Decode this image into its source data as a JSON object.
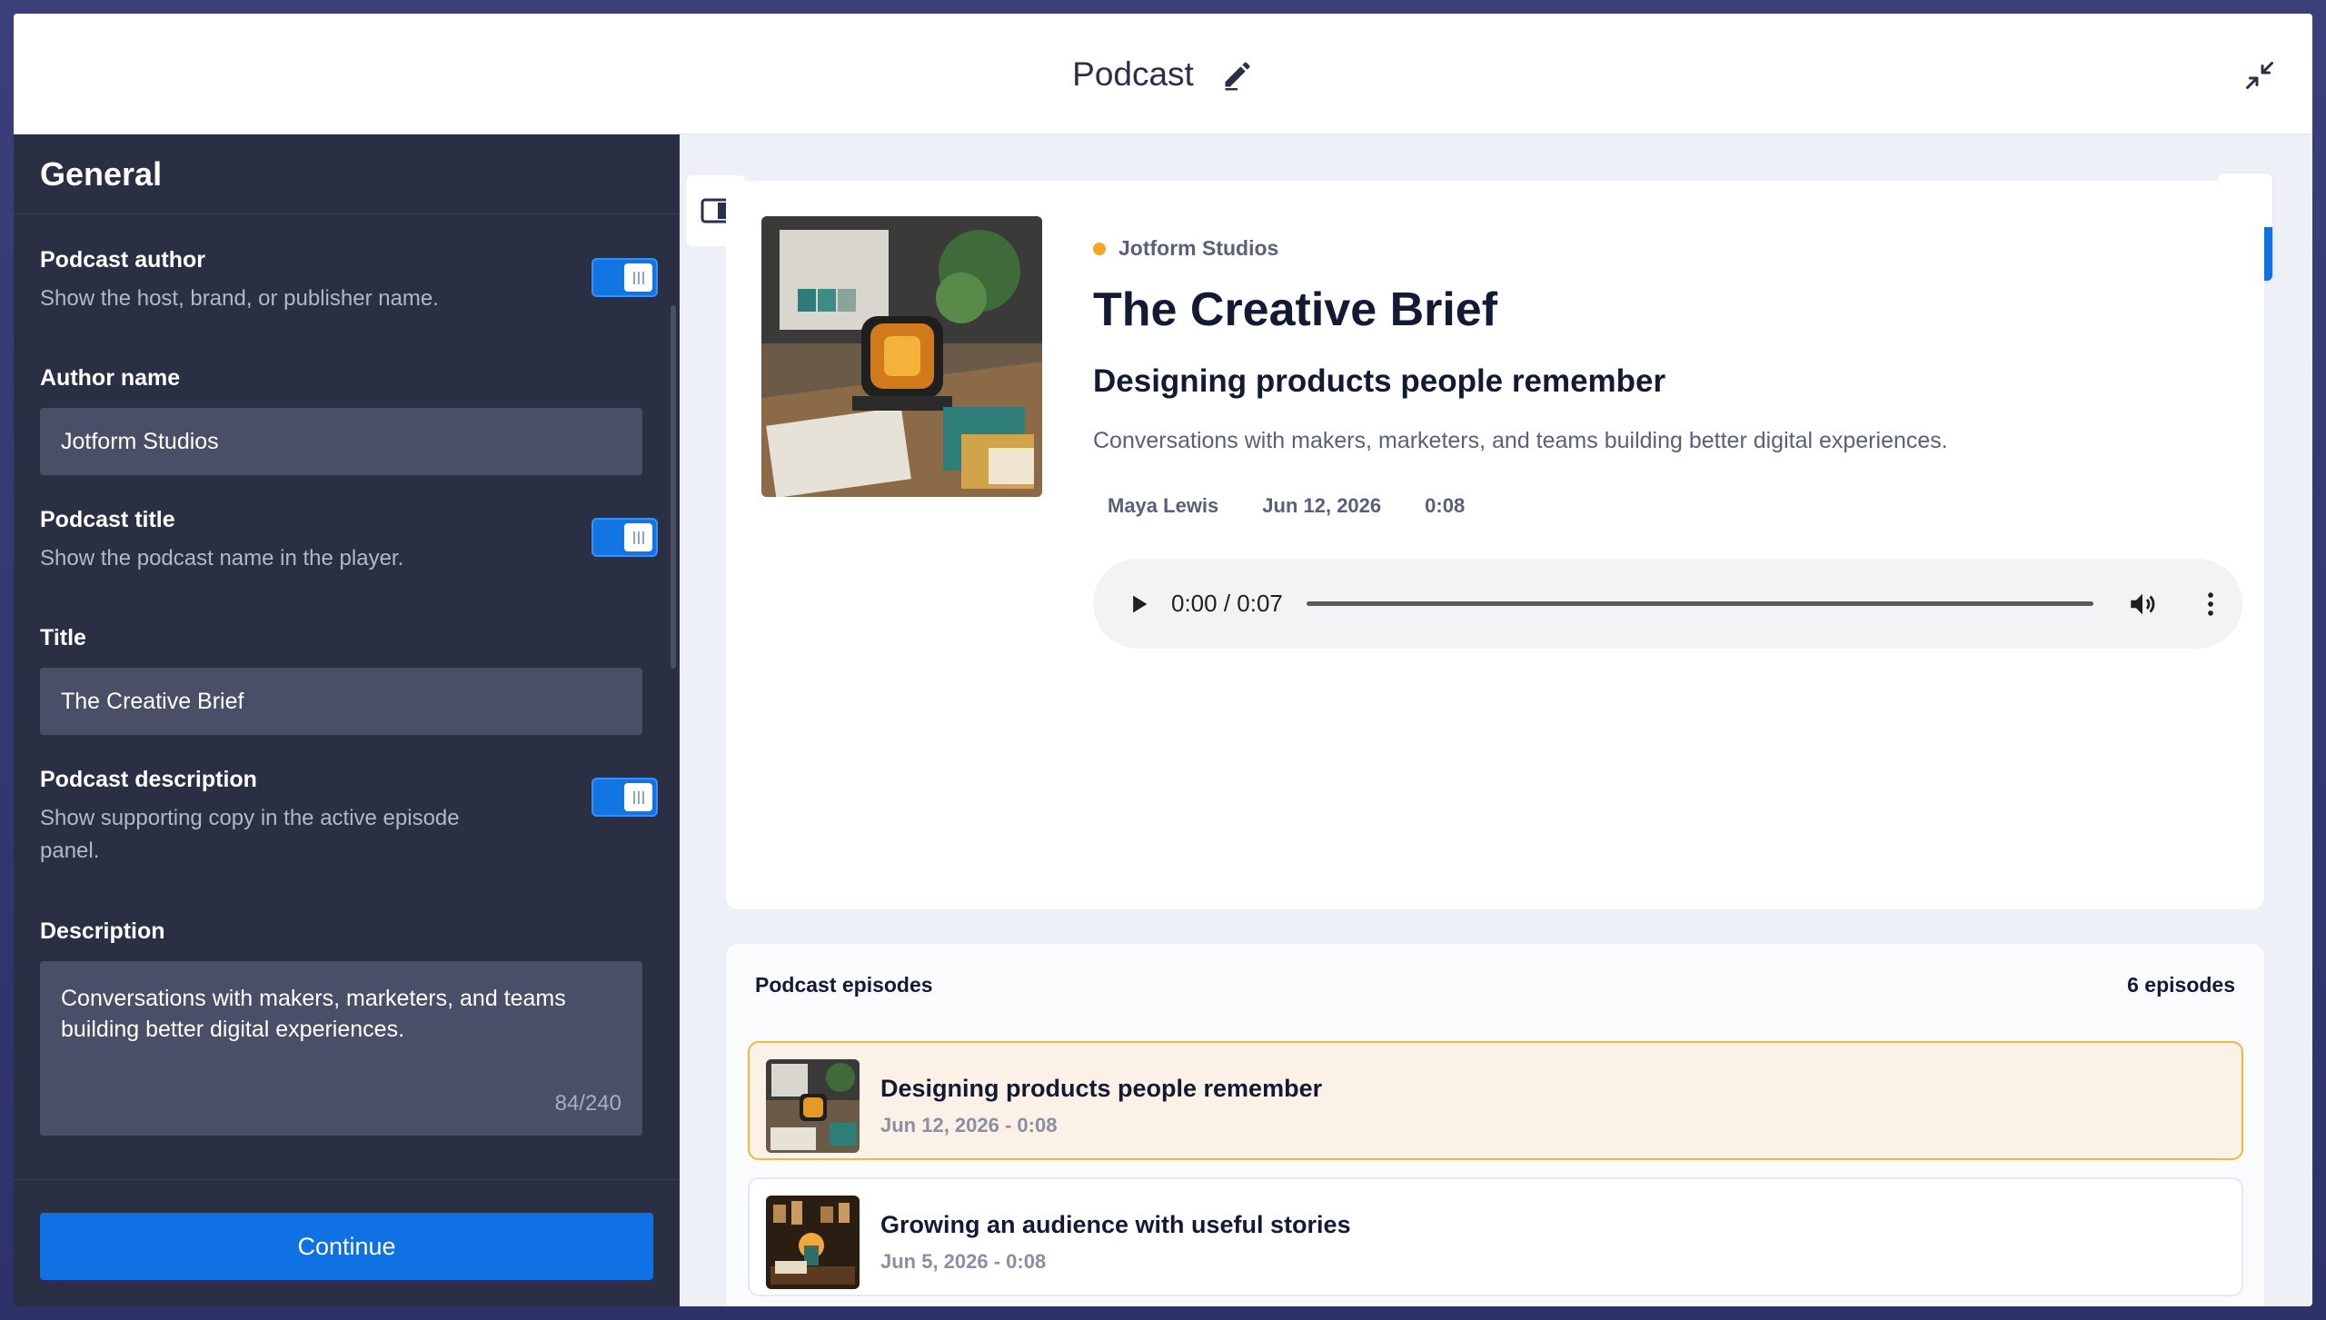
{
  "header": {
    "title": "Podcast"
  },
  "sidebar": {
    "heading": "General",
    "podcast_author": {
      "label": "Podcast author",
      "desc": "Show the host, brand, or publisher name."
    },
    "author_name": {
      "label": "Author name",
      "value": "Jotform Studios"
    },
    "podcast_title": {
      "label": "Podcast title",
      "desc": "Show the podcast name in the player."
    },
    "title_field": {
      "label": "Title",
      "value": "The Creative Brief"
    },
    "podcast_description": {
      "label": "Podcast description",
      "desc": "Show supporting copy in the active episode panel."
    },
    "description_field": {
      "label": "Description",
      "value": "Conversations with makers, marketers, and teams building better digital experiences.",
      "counter": "84/240"
    },
    "continue_label": "Continue"
  },
  "player": {
    "studio": "Jotform Studios",
    "title": "The Creative Brief",
    "episode_title": "Designing products people remember",
    "description": "Conversations with makers, marketers, and teams building better digital experiences.",
    "meta": {
      "author": "Maya Lewis",
      "date": "Jun 12, 2026",
      "duration": "0:08"
    },
    "audio_time": "0:00 / 0:07"
  },
  "episodes": {
    "heading": "Podcast episodes",
    "count": "6 episodes",
    "items": [
      {
        "title": "Designing products people remember",
        "sub": "Jun 12, 2026 - 0:08"
      },
      {
        "title": "Growing an audience with useful stories",
        "sub": "Jun 5, 2026 - 0:08"
      }
    ]
  },
  "colors": {
    "accent": "#0f71e3",
    "sidebar_bg": "#2b2f44",
    "studio_dot": "#f5a623",
    "active_episode_border": "#f0b83e"
  },
  "icons": [
    "edit-icon",
    "collapse-icon",
    "layout-toggle-icon",
    "mobile-icon",
    "desktop-icon",
    "play-icon",
    "volume-icon",
    "more-icon"
  ]
}
